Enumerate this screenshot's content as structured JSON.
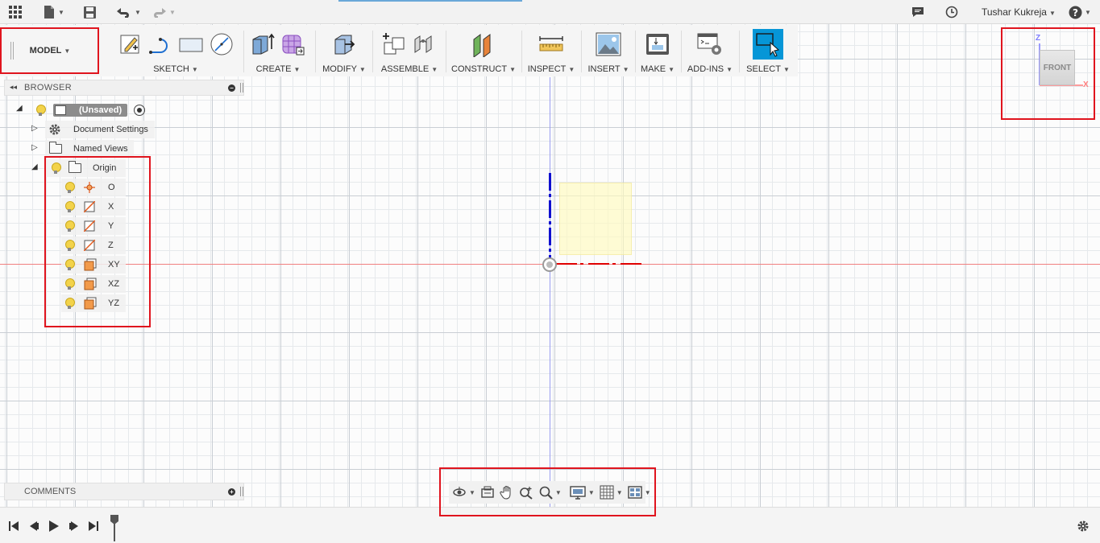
{
  "topbar": {
    "user_name": "Tushar Kukreja"
  },
  "ribbon": {
    "workspace": "MODEL",
    "groups": [
      {
        "label": "SKETCH"
      },
      {
        "label": "CREATE"
      },
      {
        "label": "MODIFY"
      },
      {
        "label": "ASSEMBLE"
      },
      {
        "label": "CONSTRUCT"
      },
      {
        "label": "INSPECT"
      },
      {
        "label": "INSERT"
      },
      {
        "label": "MAKE"
      },
      {
        "label": "ADD-INS"
      },
      {
        "label": "SELECT"
      }
    ],
    "caret": "▼"
  },
  "browser": {
    "title": "BROWSER",
    "root": "(Unsaved)",
    "items": [
      {
        "label": "Document Settings"
      },
      {
        "label": "Named Views"
      },
      {
        "label": "Origin"
      }
    ],
    "origin_children": [
      {
        "label": "O",
        "icon": "point-icon"
      },
      {
        "label": "X",
        "icon": "axis-icon"
      },
      {
        "label": "Y",
        "icon": "axis-icon"
      },
      {
        "label": "Z",
        "icon": "axis-icon"
      },
      {
        "label": "XY",
        "icon": "plane-icon"
      },
      {
        "label": "XZ",
        "icon": "plane-icon"
      },
      {
        "label": "YZ",
        "icon": "plane-icon"
      }
    ]
  },
  "comments": {
    "title": "COMMENTS"
  },
  "viewcube": {
    "face": "FRONT",
    "z": "Z",
    "x": "X",
    "z_color": "#7c7cff",
    "x_color": "#ff7c7c"
  },
  "colors": {
    "accent_blue": "#0696d7",
    "highlight_red": "#e0141e",
    "bulb_yellow": "#f3d34a",
    "plane_orange": "#f29a4a"
  }
}
